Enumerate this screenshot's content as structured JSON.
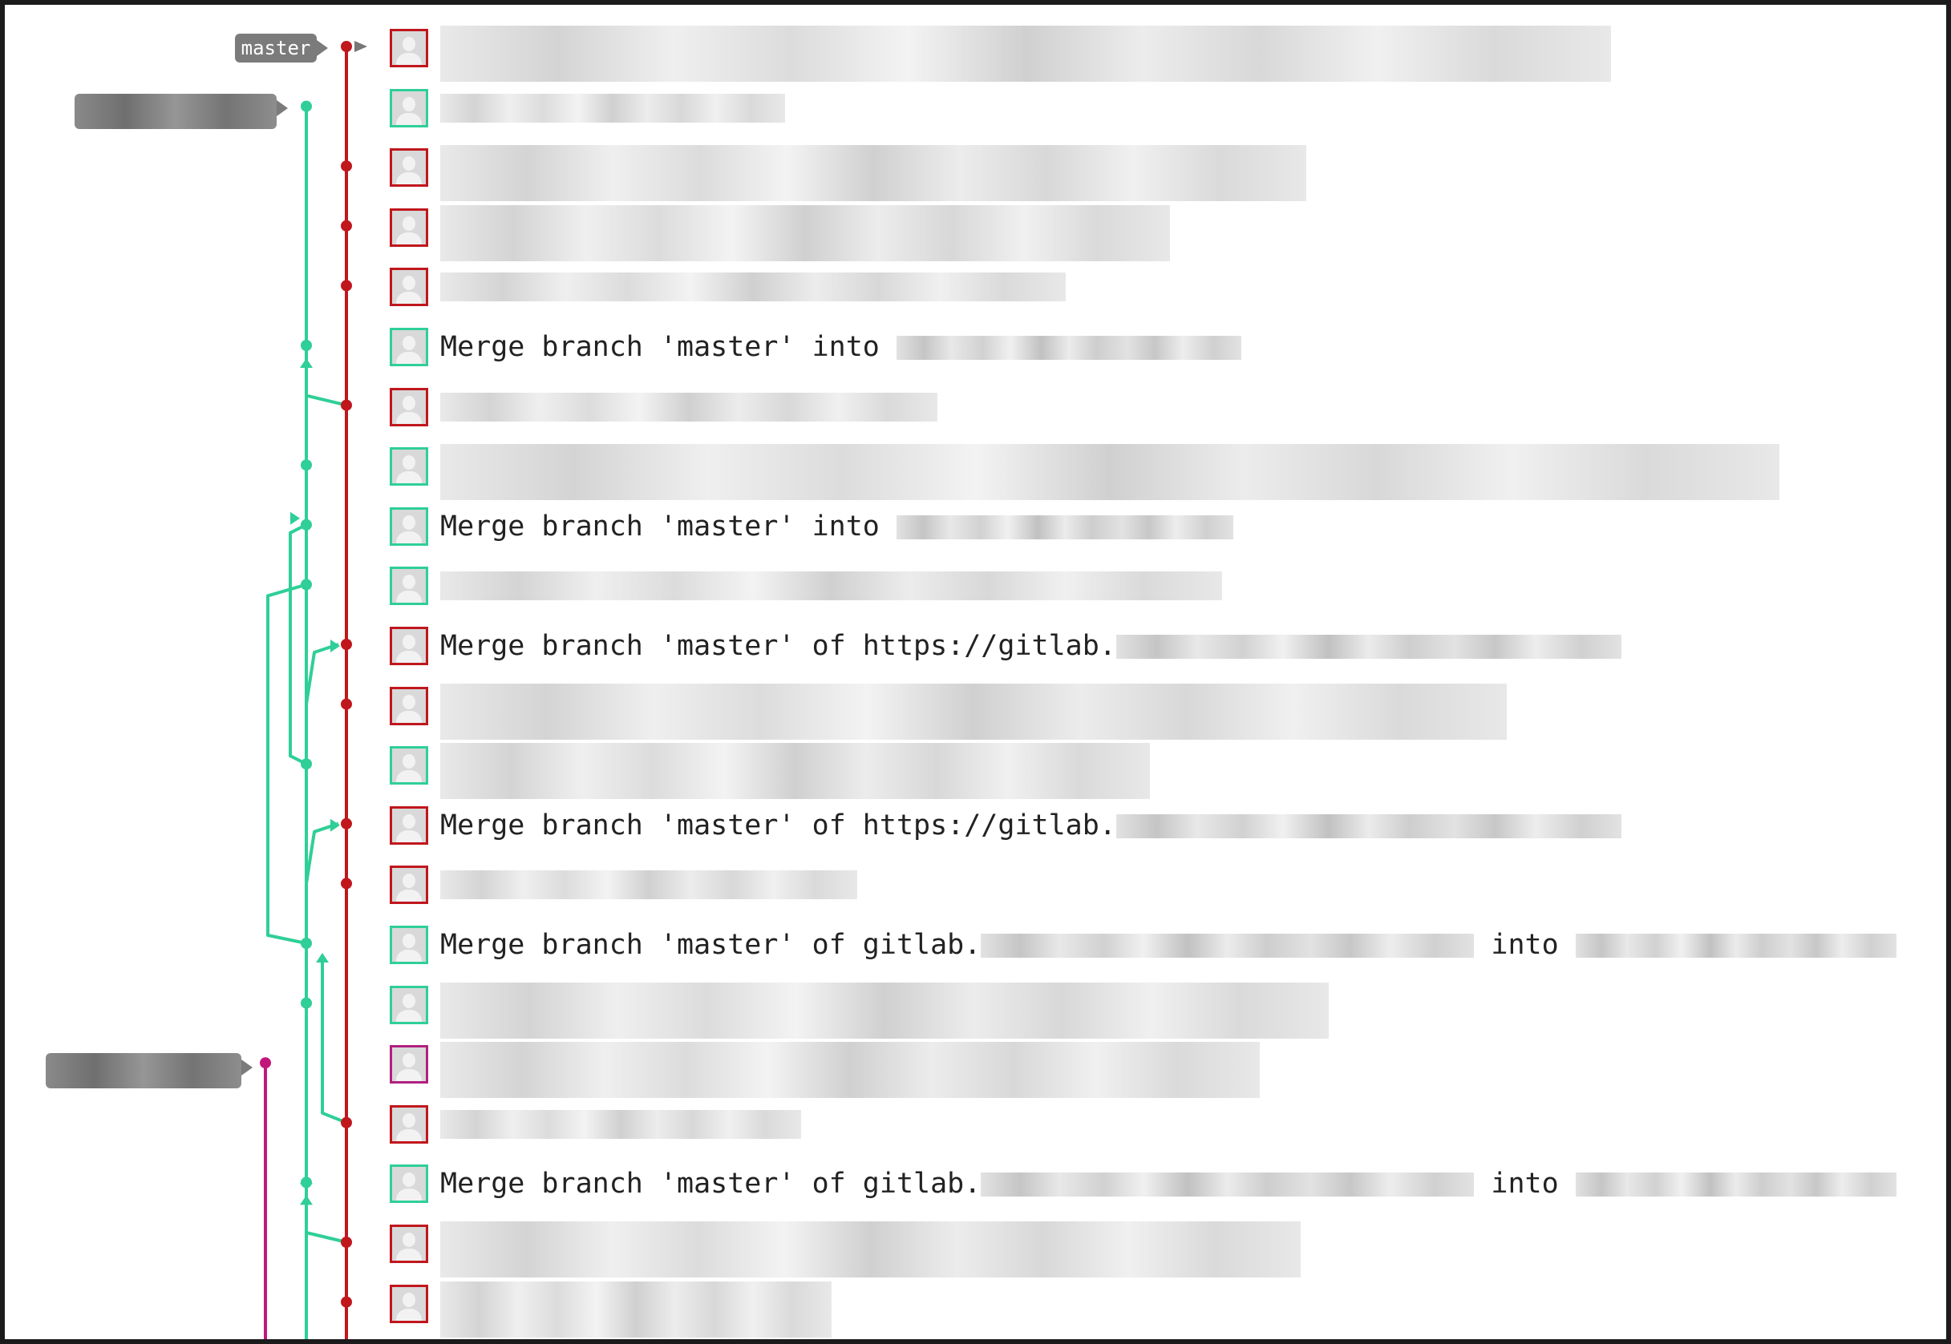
{
  "branch_labels": {
    "master": "master"
  },
  "colors": {
    "master_lane": "#c0171d",
    "feature_lane": "#2fcf97",
    "other_lane": "#c2177a",
    "tag_bg": "#7b7b7b"
  },
  "commits": [
    {
      "message": "",
      "avatar": "red",
      "visible_text": ""
    },
    {
      "message": "",
      "avatar": "green",
      "visible_text": ""
    },
    {
      "message": "",
      "avatar": "red",
      "visible_text": ""
    },
    {
      "message": "",
      "avatar": "red",
      "visible_text": ""
    },
    {
      "message": "",
      "avatar": "red",
      "visible_text": ""
    },
    {
      "message": "Merge branch 'master' into ",
      "avatar": "green",
      "visible_text": "Merge branch 'master' into "
    },
    {
      "message": "",
      "avatar": "red",
      "visible_text": ""
    },
    {
      "message": "",
      "avatar": "green",
      "visible_text": ""
    },
    {
      "message": "Merge branch 'master' into ",
      "avatar": "green",
      "visible_text": "Merge branch 'master' into "
    },
    {
      "message": "",
      "avatar": "green",
      "visible_text": ""
    },
    {
      "message": "Merge branch 'master' of https://gitlab.",
      "avatar": "red",
      "visible_text": "Merge branch 'master' of https://gitlab."
    },
    {
      "message": "",
      "avatar": "red",
      "visible_text": ""
    },
    {
      "message": "",
      "avatar": "green",
      "visible_text": ""
    },
    {
      "message": "Merge branch 'master' of https://gitlab.",
      "avatar": "red",
      "visible_text": "Merge branch 'master' of https://gitlab."
    },
    {
      "message": "",
      "avatar": "red",
      "visible_text": ""
    },
    {
      "message": "Merge branch 'master' of gitlab.",
      "avatar": "green",
      "visible_text": "Merge branch 'master' of gitlab.",
      "suffix": " into "
    },
    {
      "message": "",
      "avatar": "green",
      "visible_text": ""
    },
    {
      "message": "",
      "avatar": "purple",
      "visible_text": ""
    },
    {
      "message": "",
      "avatar": "red",
      "visible_text": ""
    },
    {
      "message": "Merge branch 'master' of gitlab.",
      "avatar": "green",
      "visible_text": "Merge branch 'master' of gitlab.",
      "suffix": " into "
    },
    {
      "message": "",
      "avatar": "red",
      "visible_text": ""
    },
    {
      "message": "",
      "avatar": "red",
      "visible_text": ""
    }
  ],
  "icons": [
    "avatar-placeholder-icon",
    "branch-pointer-icon"
  ]
}
